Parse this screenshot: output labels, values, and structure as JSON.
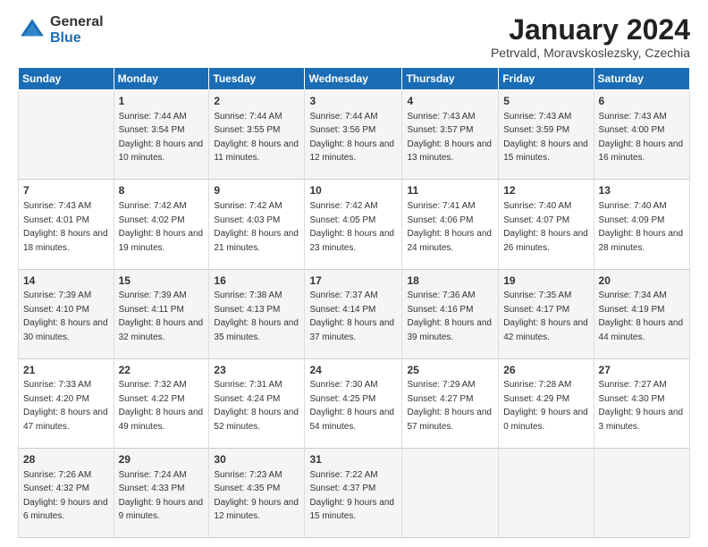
{
  "logo": {
    "general": "General",
    "blue": "Blue"
  },
  "title": {
    "month": "January 2024",
    "location": "Petrvald, Moravskoslezsky, Czechia"
  },
  "weekdays": [
    "Sunday",
    "Monday",
    "Tuesday",
    "Wednesday",
    "Thursday",
    "Friday",
    "Saturday"
  ],
  "weeks": [
    [
      {
        "day": "",
        "sunrise": "",
        "sunset": "",
        "daylight": ""
      },
      {
        "day": "1",
        "sunrise": "Sunrise: 7:44 AM",
        "sunset": "Sunset: 3:54 PM",
        "daylight": "Daylight: 8 hours and 10 minutes."
      },
      {
        "day": "2",
        "sunrise": "Sunrise: 7:44 AM",
        "sunset": "Sunset: 3:55 PM",
        "daylight": "Daylight: 8 hours and 11 minutes."
      },
      {
        "day": "3",
        "sunrise": "Sunrise: 7:44 AM",
        "sunset": "Sunset: 3:56 PM",
        "daylight": "Daylight: 8 hours and 12 minutes."
      },
      {
        "day": "4",
        "sunrise": "Sunrise: 7:43 AM",
        "sunset": "Sunset: 3:57 PM",
        "daylight": "Daylight: 8 hours and 13 minutes."
      },
      {
        "day": "5",
        "sunrise": "Sunrise: 7:43 AM",
        "sunset": "Sunset: 3:59 PM",
        "daylight": "Daylight: 8 hours and 15 minutes."
      },
      {
        "day": "6",
        "sunrise": "Sunrise: 7:43 AM",
        "sunset": "Sunset: 4:00 PM",
        "daylight": "Daylight: 8 hours and 16 minutes."
      }
    ],
    [
      {
        "day": "7",
        "sunrise": "Sunrise: 7:43 AM",
        "sunset": "Sunset: 4:01 PM",
        "daylight": "Daylight: 8 hours and 18 minutes."
      },
      {
        "day": "8",
        "sunrise": "Sunrise: 7:42 AM",
        "sunset": "Sunset: 4:02 PM",
        "daylight": "Daylight: 8 hours and 19 minutes."
      },
      {
        "day": "9",
        "sunrise": "Sunrise: 7:42 AM",
        "sunset": "Sunset: 4:03 PM",
        "daylight": "Daylight: 8 hours and 21 minutes."
      },
      {
        "day": "10",
        "sunrise": "Sunrise: 7:42 AM",
        "sunset": "Sunset: 4:05 PM",
        "daylight": "Daylight: 8 hours and 23 minutes."
      },
      {
        "day": "11",
        "sunrise": "Sunrise: 7:41 AM",
        "sunset": "Sunset: 4:06 PM",
        "daylight": "Daylight: 8 hours and 24 minutes."
      },
      {
        "day": "12",
        "sunrise": "Sunrise: 7:40 AM",
        "sunset": "Sunset: 4:07 PM",
        "daylight": "Daylight: 8 hours and 26 minutes."
      },
      {
        "day": "13",
        "sunrise": "Sunrise: 7:40 AM",
        "sunset": "Sunset: 4:09 PM",
        "daylight": "Daylight: 8 hours and 28 minutes."
      }
    ],
    [
      {
        "day": "14",
        "sunrise": "Sunrise: 7:39 AM",
        "sunset": "Sunset: 4:10 PM",
        "daylight": "Daylight: 8 hours and 30 minutes."
      },
      {
        "day": "15",
        "sunrise": "Sunrise: 7:39 AM",
        "sunset": "Sunset: 4:11 PM",
        "daylight": "Daylight: 8 hours and 32 minutes."
      },
      {
        "day": "16",
        "sunrise": "Sunrise: 7:38 AM",
        "sunset": "Sunset: 4:13 PM",
        "daylight": "Daylight: 8 hours and 35 minutes."
      },
      {
        "day": "17",
        "sunrise": "Sunrise: 7:37 AM",
        "sunset": "Sunset: 4:14 PM",
        "daylight": "Daylight: 8 hours and 37 minutes."
      },
      {
        "day": "18",
        "sunrise": "Sunrise: 7:36 AM",
        "sunset": "Sunset: 4:16 PM",
        "daylight": "Daylight: 8 hours and 39 minutes."
      },
      {
        "day": "19",
        "sunrise": "Sunrise: 7:35 AM",
        "sunset": "Sunset: 4:17 PM",
        "daylight": "Daylight: 8 hours and 42 minutes."
      },
      {
        "day": "20",
        "sunrise": "Sunrise: 7:34 AM",
        "sunset": "Sunset: 4:19 PM",
        "daylight": "Daylight: 8 hours and 44 minutes."
      }
    ],
    [
      {
        "day": "21",
        "sunrise": "Sunrise: 7:33 AM",
        "sunset": "Sunset: 4:20 PM",
        "daylight": "Daylight: 8 hours and 47 minutes."
      },
      {
        "day": "22",
        "sunrise": "Sunrise: 7:32 AM",
        "sunset": "Sunset: 4:22 PM",
        "daylight": "Daylight: 8 hours and 49 minutes."
      },
      {
        "day": "23",
        "sunrise": "Sunrise: 7:31 AM",
        "sunset": "Sunset: 4:24 PM",
        "daylight": "Daylight: 8 hours and 52 minutes."
      },
      {
        "day": "24",
        "sunrise": "Sunrise: 7:30 AM",
        "sunset": "Sunset: 4:25 PM",
        "daylight": "Daylight: 8 hours and 54 minutes."
      },
      {
        "day": "25",
        "sunrise": "Sunrise: 7:29 AM",
        "sunset": "Sunset: 4:27 PM",
        "daylight": "Daylight: 8 hours and 57 minutes."
      },
      {
        "day": "26",
        "sunrise": "Sunrise: 7:28 AM",
        "sunset": "Sunset: 4:29 PM",
        "daylight": "Daylight: 9 hours and 0 minutes."
      },
      {
        "day": "27",
        "sunrise": "Sunrise: 7:27 AM",
        "sunset": "Sunset: 4:30 PM",
        "daylight": "Daylight: 9 hours and 3 minutes."
      }
    ],
    [
      {
        "day": "28",
        "sunrise": "Sunrise: 7:26 AM",
        "sunset": "Sunset: 4:32 PM",
        "daylight": "Daylight: 9 hours and 6 minutes."
      },
      {
        "day": "29",
        "sunrise": "Sunrise: 7:24 AM",
        "sunset": "Sunset: 4:33 PM",
        "daylight": "Daylight: 9 hours and 9 minutes."
      },
      {
        "day": "30",
        "sunrise": "Sunrise: 7:23 AM",
        "sunset": "Sunset: 4:35 PM",
        "daylight": "Daylight: 9 hours and 12 minutes."
      },
      {
        "day": "31",
        "sunrise": "Sunrise: 7:22 AM",
        "sunset": "Sunset: 4:37 PM",
        "daylight": "Daylight: 9 hours and 15 minutes."
      },
      {
        "day": "",
        "sunrise": "",
        "sunset": "",
        "daylight": ""
      },
      {
        "day": "",
        "sunrise": "",
        "sunset": "",
        "daylight": ""
      },
      {
        "day": "",
        "sunrise": "",
        "sunset": "",
        "daylight": ""
      }
    ]
  ]
}
